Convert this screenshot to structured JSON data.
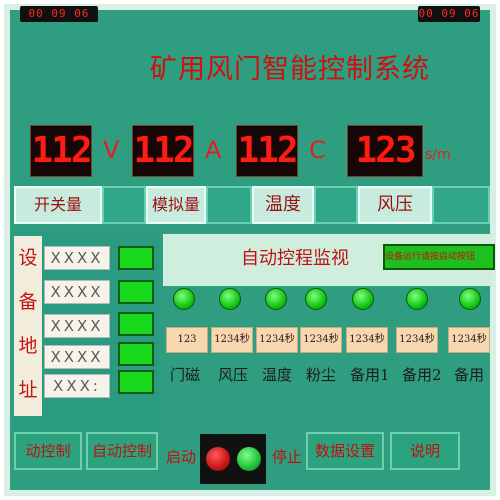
{
  "header": {
    "clock_left": "00 09 06",
    "clock_right": "00 09 06",
    "title": "矿用风门智能控制系统"
  },
  "meters": [
    {
      "value": "112",
      "unit": "V"
    },
    {
      "value": "112",
      "unit": "A"
    },
    {
      "value": "112",
      "unit": "C"
    },
    {
      "value": "123",
      "unit": "s/m"
    }
  ],
  "tabs": [
    {
      "label": "开关量"
    },
    {
      "label": "模拟量"
    },
    {
      "label": "温度"
    },
    {
      "label": "风压"
    }
  ],
  "address": {
    "label": "设备地址",
    "chars": [
      "设",
      "备",
      "地",
      "址"
    ],
    "rows": [
      "XXXX",
      "XXXX",
      "XXXX",
      "XXXX",
      "XXX:"
    ]
  },
  "monitor": {
    "title": "自动控程监视",
    "alert_text": "设备运行请按启动按钮"
  },
  "channels": [
    {
      "label": "门磁",
      "value": "123"
    },
    {
      "label": "风压",
      "value": "1234秒"
    },
    {
      "label": "温度",
      "value": "1234秒"
    },
    {
      "label": "粉尘",
      "value": "1234秒"
    },
    {
      "label": "备用1",
      "value": "1234秒"
    },
    {
      "label": "备用2",
      "value": "1234秒"
    },
    {
      "label": "备用",
      "value": "1234秒"
    }
  ],
  "buttons": {
    "manual": "动控制",
    "auto": "自动控制",
    "start": "启动",
    "stop": "停止",
    "data": "数据设置",
    "help": "说明"
  },
  "colors": {
    "background": "#2f9e80",
    "digit_red": "#ff1a12",
    "lamp_green": "#12c612",
    "stop_red": "#c81414",
    "run_green": "#1fbf3a"
  }
}
